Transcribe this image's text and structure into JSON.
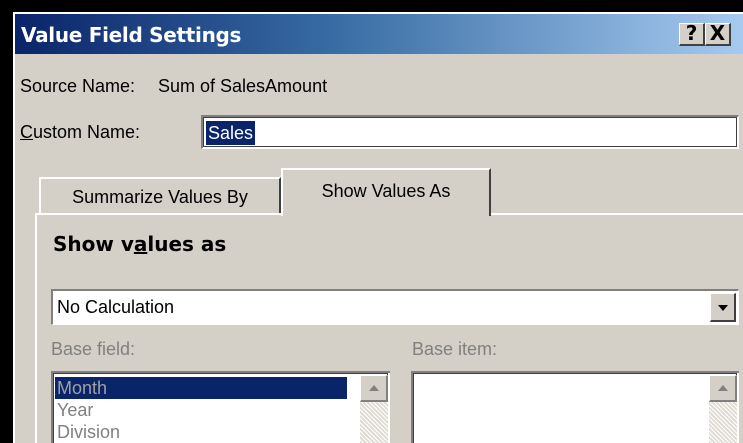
{
  "window": {
    "title": "Value Field Settings",
    "help_glyph": "?",
    "close_glyph": "X"
  },
  "source": {
    "label": "Source Name:",
    "value": "Sum of SalesAmount"
  },
  "custom_name": {
    "label_first": "C",
    "label_rest": "ustom Name:",
    "value": "Sales"
  },
  "tabs": [
    {
      "label": "Summarize Values By",
      "active": false
    },
    {
      "label": "Show Values As",
      "active": true
    }
  ],
  "show_values": {
    "title_a": "Show v",
    "title_u": "a",
    "title_b": "lues as",
    "selected": "No Calculation"
  },
  "base_field": {
    "label": "Base field:",
    "items": [
      "Month",
      "Year",
      "Division"
    ],
    "selected": "Month"
  },
  "base_item": {
    "label": "Base item:",
    "items": []
  },
  "colors": {
    "titlebar_start": "#0a246a",
    "titlebar_end": "#a6caf0",
    "selection": "#0a246a",
    "face": "#d4d0c8"
  }
}
